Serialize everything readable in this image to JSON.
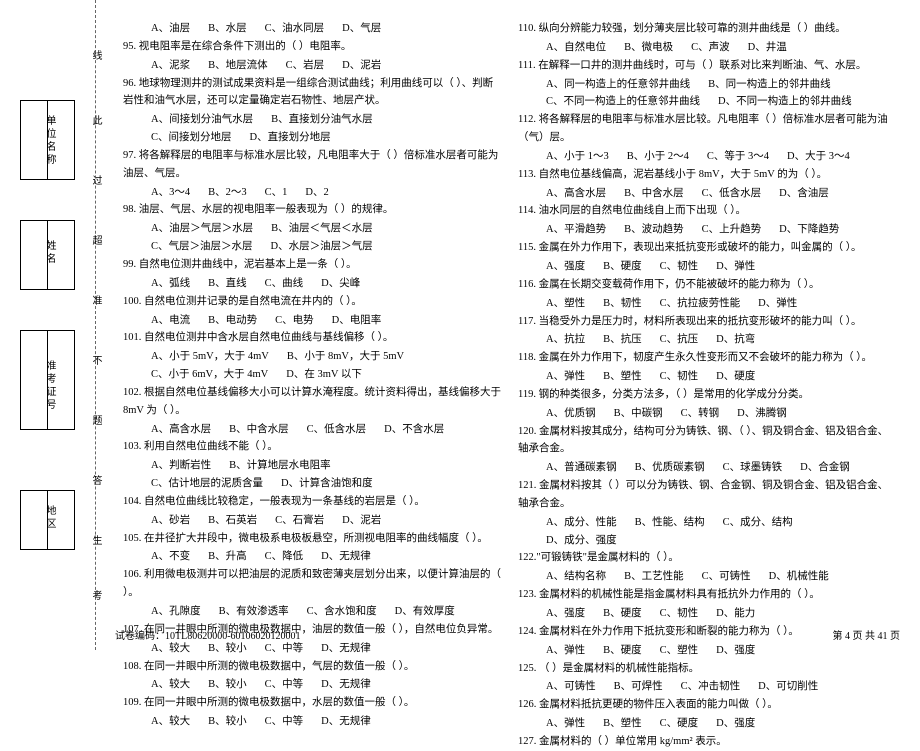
{
  "sidebar": {
    "box1_label": "单位名称",
    "box2_label": "姓名",
    "box3_label": "准考证号",
    "box4_label": "地区"
  },
  "dashed": {
    "l1": "线",
    "l2": "此",
    "l3": "过",
    "l4": "超",
    "l5": "准",
    "l6": "不",
    "l7": "题",
    "l8": "答",
    "l9": "生",
    "l10": "考"
  },
  "left_col": [
    {
      "type": "opts",
      "opts": [
        "A、油层",
        "B、水层",
        "C、油水同层",
        "D、气层"
      ]
    },
    {
      "type": "q",
      "text": "95. 视电阻率是在综合条件下测出的（    ）电阻率。"
    },
    {
      "type": "opts",
      "opts": [
        "A、泥浆",
        "B、地层流体",
        "C、岩层",
        "D、泥岩"
      ]
    },
    {
      "type": "q",
      "text": "96. 地球物理测井的测试成果资料是一组综合测试曲线；利用曲线可以（    ）、判断岩性和油气水层，还可以定量确定岩石物性、地层产状。"
    },
    {
      "type": "opts",
      "opts": [
        "A、间接划分油气水层",
        "B、直接划分油气水层"
      ]
    },
    {
      "type": "opts",
      "opts": [
        "C、间接划分地层",
        "D、直接划分地层"
      ]
    },
    {
      "type": "q",
      "text": "97. 将各解释层的电阻率与标准水层比较，凡电阻率大于（    ）倍标准水层者可能为油层、气层。"
    },
    {
      "type": "opts",
      "opts": [
        "A、3～4",
        "B、2～3",
        "C、1",
        "D、2"
      ]
    },
    {
      "type": "q",
      "text": "98. 油层、气层、水层的视电阻率一般表现为（    ）的规律。"
    },
    {
      "type": "opts",
      "opts": [
        "A、油层＞气层＞水层",
        "B、油层＜气层＜水层"
      ]
    },
    {
      "type": "opts",
      "opts": [
        "C、气层＞油层＞水层",
        "D、水层＞油层＞气层"
      ]
    },
    {
      "type": "q",
      "text": "99. 自然电位测井曲线中，泥岩基本上是一条（    ）。"
    },
    {
      "type": "opts",
      "opts": [
        "A、弧线",
        "B、直线",
        "C、曲线",
        "D、尖峰"
      ]
    },
    {
      "type": "q",
      "text": "100. 自然电位测井记录的是自然电流在井内的（    ）。"
    },
    {
      "type": "opts",
      "opts": [
        "A、电流",
        "B、电动势",
        "C、电势",
        "D、电阻率"
      ]
    },
    {
      "type": "q",
      "text": "101. 自然电位测井中含水层自然电位曲线与基线偏移（    ）。"
    },
    {
      "type": "opts",
      "opts": [
        "A、小于 5mV，大于 4mV",
        "B、小于 8mV，大于 5mV"
      ]
    },
    {
      "type": "opts",
      "opts": [
        "C、小于 6mV，大于 4mV",
        "D、在 3mV 以下"
      ]
    },
    {
      "type": "q",
      "text": "102. 根据自然电位基线偏移大小可以计算水淹程度。统计资料得出，基线偏移大于 8mV 为（    ）。"
    },
    {
      "type": "opts",
      "opts": [
        "A、高含水层",
        "B、中含水层",
        "C、低含水层",
        "D、不含水层"
      ]
    },
    {
      "type": "q",
      "text": "103. 利用自然电位曲线不能（    ）。"
    },
    {
      "type": "opts",
      "opts": [
        "A、判断岩性",
        "B、计算地层水电阻率"
      ]
    },
    {
      "type": "opts",
      "opts": [
        "C、估计地层的泥质含量",
        "D、计算含油饱和度"
      ]
    },
    {
      "type": "q",
      "text": "104. 自然电位曲线比较稳定，一般表现为一条基线的岩层是（    ）。"
    },
    {
      "type": "opts",
      "opts": [
        "A、砂岩",
        "B、石英岩",
        "C、石膏岩",
        "D、泥岩"
      ]
    },
    {
      "type": "q",
      "text": "105. 在井径扩大井段中，微电极系电极板悬空，所测视电阻率的曲线幅度（    ）。"
    },
    {
      "type": "opts",
      "opts": [
        "A、不变",
        "B、升高",
        "C、降低",
        "D、无规律"
      ]
    },
    {
      "type": "q",
      "text": "106. 利用微电极测井可以把油层的泥质和致密薄夹层划分出来，以便计算油层的（    ）。"
    },
    {
      "type": "opts",
      "opts": [
        "A、孔隙度",
        "B、有效渗透率",
        "C、含水饱和度",
        "D、有效厚度"
      ]
    },
    {
      "type": "q",
      "text": "107. 在同一井眼中所测的微电极数据中，油层的数值一般（    ），自然电位负异常。"
    },
    {
      "type": "opts",
      "opts": [
        "A、较大",
        "B、较小",
        "C、中等",
        "D、无规律"
      ]
    },
    {
      "type": "q",
      "text": "108. 在同一井眼中所测的微电极数据中，气层的数值一般（    ）。"
    },
    {
      "type": "opts",
      "opts": [
        "A、较大",
        "B、较小",
        "C、中等",
        "D、无规律"
      ]
    },
    {
      "type": "q",
      "text": "109. 在同一井眼中所测的微电极数据中，水层的数值一般（    ）。"
    },
    {
      "type": "opts",
      "opts": [
        "A、较大",
        "B、较小",
        "C、中等",
        "D、无规律"
      ]
    }
  ],
  "right_col": [
    {
      "type": "q",
      "text": "110. 纵向分辨能力较强，划分薄夹层比较可靠的测井曲线是（    ）曲线。"
    },
    {
      "type": "opts",
      "opts": [
        "A、自然电位",
        "B、微电极",
        "C、声波",
        "D、井温"
      ]
    },
    {
      "type": "q",
      "text": "111. 在解释一口井的测井曲线时，可与（    ）联系对比来判断油、气、水层。"
    },
    {
      "type": "opts",
      "opts": [
        "A、同一构造上的任意邻井曲线",
        "B、同一构造上的邻井曲线"
      ]
    },
    {
      "type": "opts",
      "opts": [
        "C、不同一构造上的任意邻井曲线",
        "D、不同一构造上的邻井曲线"
      ]
    },
    {
      "type": "q",
      "text": "112. 将各解释层的电阻率与标准水层比较。凡电阻率（    ）倍标准水层者可能为油（气）层。"
    },
    {
      "type": "opts",
      "opts": [
        "A、小于 1～3",
        "B、小于 2～4",
        "C、等于 3～4",
        "D、大于 3～4"
      ]
    },
    {
      "type": "q",
      "text": "113. 自然电位基线偏高，泥岩基线小于 8mV，大于 5mV 的为（    ）。"
    },
    {
      "type": "opts",
      "opts": [
        "A、高含水层",
        "B、中含水层",
        "C、低含水层",
        "D、含油层"
      ]
    },
    {
      "type": "q",
      "text": "114. 油水同层的自然电位曲线自上而下出现（    ）。"
    },
    {
      "type": "opts",
      "opts": [
        "A、平滑趋势",
        "B、波动趋势",
        "C、上升趋势",
        "D、下降趋势"
      ]
    },
    {
      "type": "q",
      "text": "115. 金属在外力作用下，表现出来抵抗变形或破坏的能力，叫金属的（    ）。"
    },
    {
      "type": "opts",
      "opts": [
        "A、强度",
        "B、硬度",
        "C、韧性",
        "D、弹性"
      ]
    },
    {
      "type": "q",
      "text": "116. 金属在长期交变载荷作用下，仍不能被破坏的能力称为（    ）。"
    },
    {
      "type": "opts",
      "opts": [
        "A、塑性",
        "B、韧性",
        "C、抗拉疲劳性能",
        "D、弹性"
      ]
    },
    {
      "type": "q",
      "text": "117. 当稳受外力是压力时，材料所表现出来的抵抗变形破坏的能力叫（    ）。"
    },
    {
      "type": "opts",
      "opts": [
        "A、抗拉",
        "B、抗压",
        "C、抗压",
        "D、抗弯"
      ]
    },
    {
      "type": "q",
      "text": "118. 金属在外力作用下，韧度产生永久性变形而又不会破坏的能力称为（    ）。"
    },
    {
      "type": "opts",
      "opts": [
        "A、弹性",
        "B、塑性",
        "C、韧性",
        "D、硬度"
      ]
    },
    {
      "type": "q",
      "text": "119. 钢的种类很多，分类方法多，（    ）是常用的化学成分分类。"
    },
    {
      "type": "opts",
      "opts": [
        "A、优质钢",
        "B、中碳钢",
        "C、转钢",
        "D、沸腾钢"
      ]
    },
    {
      "type": "q",
      "text": "120. 金属材料按其成分，结构可分为铸铁、钢、（    ）、铜及铜合金、铝及铝合金、轴承合金。"
    },
    {
      "type": "opts",
      "opts": [
        "A、普通碳素钢",
        "B、优质碳素钢",
        "C、球墨铸铁",
        "D、合金钢"
      ]
    },
    {
      "type": "q",
      "text": "121. 金属材料按其（    ）可以分为铸铁、钢、合金钢、铜及铜合金、铝及铝合金、轴承合金。"
    },
    {
      "type": "opts",
      "opts": [
        "A、成分、性能",
        "B、性能、结构",
        "C、成分、结构",
        "D、成分、强度"
      ]
    },
    {
      "type": "q",
      "text": "122.\"可锻铸铁\"是金属材料的（    ）。"
    },
    {
      "type": "opts",
      "opts": [
        "A、结构名称",
        "B、工艺性能",
        "C、可铸性",
        "D、机械性能"
      ]
    },
    {
      "type": "q",
      "text": "123. 金属材料的机械性能是指金属材料具有抵抗外力作用的（    ）。"
    },
    {
      "type": "opts",
      "opts": [
        "A、强度",
        "B、硬度",
        "C、韧性",
        "D、能力"
      ]
    },
    {
      "type": "q",
      "text": "124. 金属材料在外力作用下抵抗变形和断裂的能力称为（    ）。"
    },
    {
      "type": "opts",
      "opts": [
        "A、弹性",
        "B、硬度",
        "C、塑性",
        "D、强度"
      ]
    },
    {
      "type": "q",
      "text": "125. （    ）是金属材料的机械性能指标。"
    },
    {
      "type": "opts",
      "opts": [
        "A、可铸性",
        "B、可焊性",
        "C、冲击韧性",
        "D、可切削性"
      ]
    },
    {
      "type": "q",
      "text": "126. 金属材料抵抗更硬的物件压入表面的能力叫做（    ）。"
    },
    {
      "type": "opts",
      "opts": [
        "A、弹性",
        "B、塑性",
        "C、硬度",
        "D、强度"
      ]
    },
    {
      "type": "q",
      "text": "127. 金属材料的（    ）单位常用 kg/mm² 表示。"
    }
  ],
  "footer": {
    "left": "试卷编码：10TL80620000-60106020120001",
    "right": "第 4 页    共 41 页"
  }
}
